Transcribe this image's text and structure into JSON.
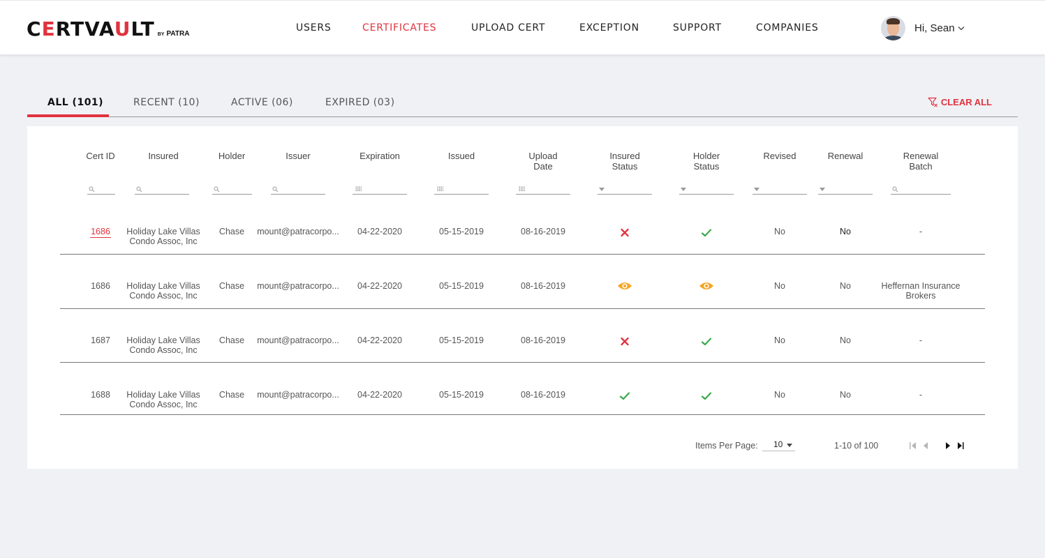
{
  "brand": {
    "name_part1": "C",
    "name_red": "E",
    "name_part2": "RTVA",
    "name_red2": "U",
    "name_part3": "LT",
    "by": "BY",
    "company": "PATRA"
  },
  "nav": {
    "items": [
      {
        "label": "USERS",
        "active": false
      },
      {
        "label": "CERTIFICATES",
        "active": true
      },
      {
        "label": "UPLOAD CERT",
        "active": false
      },
      {
        "label": "EXCEPTION",
        "active": false
      },
      {
        "label": "SUPPORT",
        "active": false
      },
      {
        "label": "COMPANIES",
        "active": false
      }
    ]
  },
  "user": {
    "greeting": "Hi, Sean"
  },
  "tabs": [
    {
      "label": "ALL (101)",
      "active": true
    },
    {
      "label": "RECENT (10)",
      "active": false
    },
    {
      "label": "ACTIVE (06)",
      "active": false
    },
    {
      "label": "EXPIRED (03)",
      "active": false
    }
  ],
  "clear_all": "CLEAR ALL",
  "table": {
    "columns": [
      {
        "l1": "Cert ID",
        "l2": "",
        "filter": "search"
      },
      {
        "l1": "Insured",
        "l2": "",
        "filter": "search"
      },
      {
        "l1": "Holder",
        "l2": "",
        "filter": "search"
      },
      {
        "l1": "Issuer",
        "l2": "",
        "filter": "search"
      },
      {
        "l1": "Expiration",
        "l2": "",
        "filter": "date"
      },
      {
        "l1": "Issued",
        "l2": "",
        "filter": "date"
      },
      {
        "l1": "Upload",
        "l2": "Date",
        "filter": "date"
      },
      {
        "l1": "Insured",
        "l2": "Status",
        "filter": "select"
      },
      {
        "l1": "Holder",
        "l2": "Status",
        "filter": "select"
      },
      {
        "l1": "Revised",
        "l2": "",
        "filter": "select"
      },
      {
        "l1": "Renewal",
        "l2": "",
        "filter": "select"
      },
      {
        "l1": "Renewal",
        "l2": "Batch",
        "filter": "search"
      }
    ],
    "rows": [
      {
        "cert_id": "1686",
        "insured1": "Holiday Lake Villas",
        "insured2": "Condo Assoc, Inc",
        "holder": "Chase",
        "issuer": "mount@patracorpo...",
        "expiration": "04-22-2020",
        "issued": "05-15-2019",
        "upload_date": "08-16-2019",
        "insured_status": "rejected",
        "holder_status": "approved",
        "revised": "No",
        "renewal": "No",
        "batch1": "-",
        "batch2": ""
      },
      {
        "cert_id": "1686",
        "insured1": "Holiday Lake Villas",
        "insured2": "Condo Assoc, Inc",
        "holder": "Chase",
        "issuer": "mount@patracorpo...",
        "expiration": "04-22-2020",
        "issued": "05-15-2019",
        "upload_date": "08-16-2019",
        "insured_status": "in-review",
        "holder_status": "in-review",
        "revised": "No",
        "renewal": "No",
        "batch1": "Heffernan Insurance",
        "batch2": "Brokers"
      },
      {
        "cert_id": "1687",
        "insured1": "Holiday Lake Villas",
        "insured2": "Condo Assoc, Inc",
        "holder": "Chase",
        "issuer": "mount@patracorpo...",
        "expiration": "04-22-2020",
        "issued": "05-15-2019",
        "upload_date": "08-16-2019",
        "insured_status": "rejected",
        "holder_status": "approved",
        "revised": "No",
        "renewal": "No",
        "batch1": "-",
        "batch2": ""
      },
      {
        "cert_id": "1688",
        "insured1": "Holiday Lake Villas",
        "insured2": "Condo Assoc, Inc",
        "holder": "Chase",
        "issuer": "mount@patracorpo...",
        "expiration": "04-22-2020",
        "issued": "05-15-2019",
        "upload_date": "08-16-2019",
        "insured_status": "approved",
        "holder_status": "approved",
        "revised": "No",
        "renewal": "No",
        "batch1": "-",
        "batch2": ""
      }
    ]
  },
  "pagination": {
    "items_per_page_label": "Items Per Page:",
    "page_size": "10",
    "range": "1-10 of 100"
  },
  "colors": {
    "accent": "#e0333e",
    "approved": "#3aa84a",
    "rejected": "#e0333e",
    "in_review": "#f5a623"
  }
}
